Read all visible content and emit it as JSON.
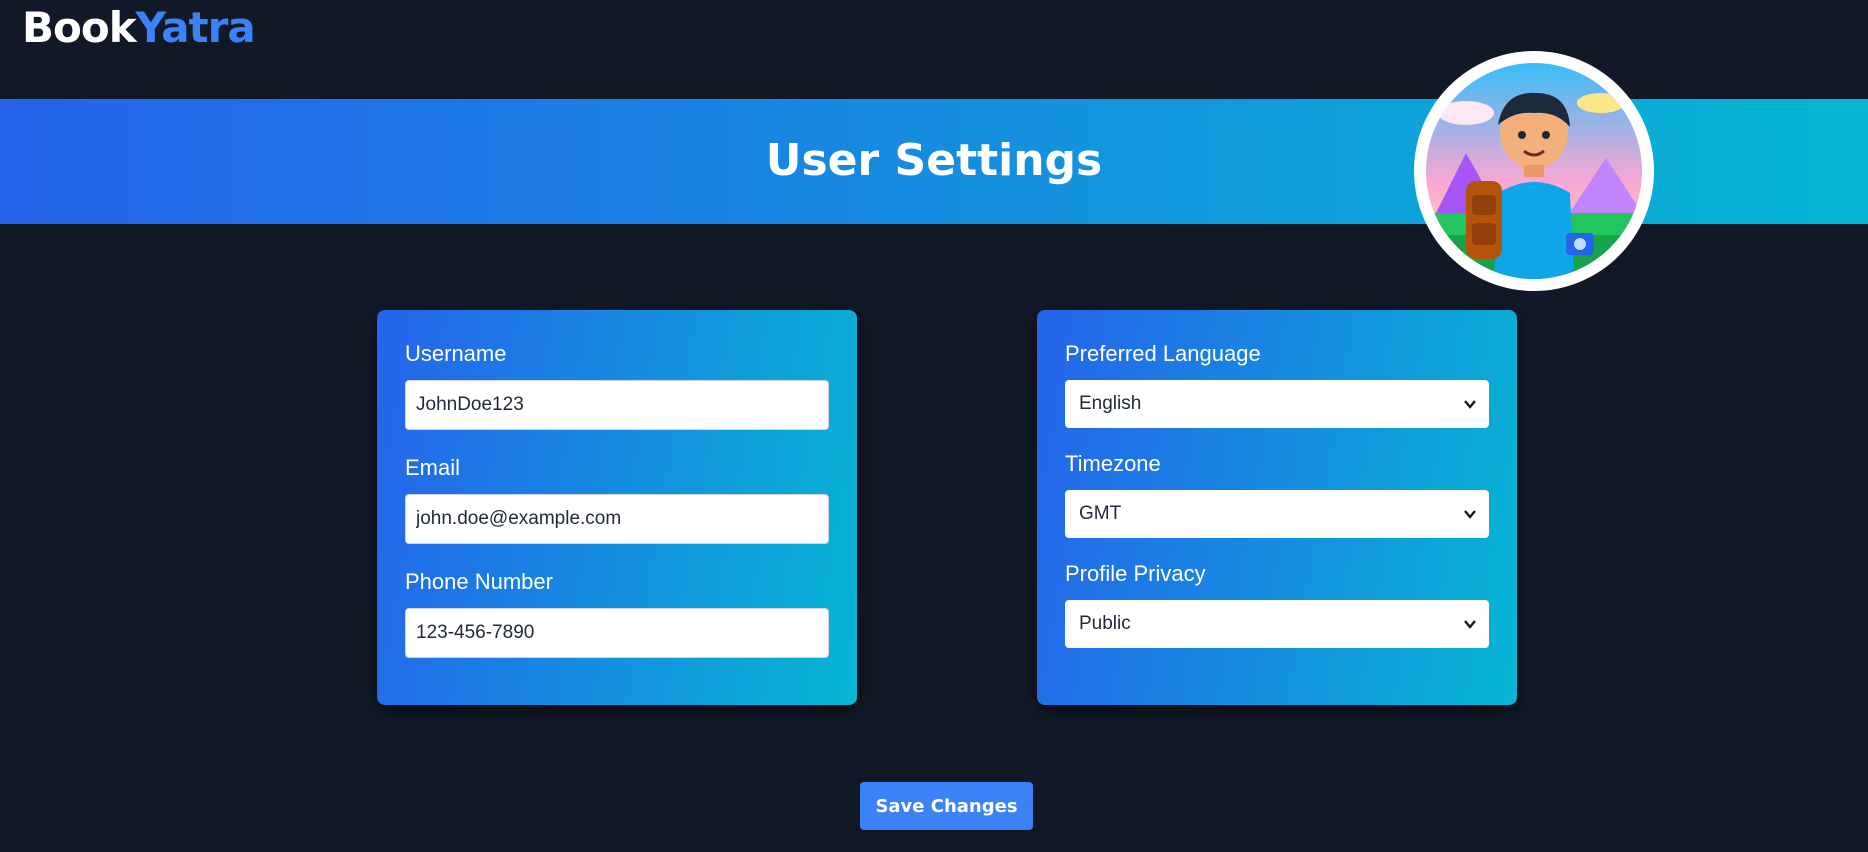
{
  "brand": {
    "part1": "Book",
    "part2": "Yatra",
    "accent_color": "#3b82f6"
  },
  "banner": {
    "title": "User Settings",
    "gradient": [
      "#2563eb",
      "#06b6d4"
    ]
  },
  "avatar": {
    "icon": "traveler-avatar-illustration"
  },
  "account_form": {
    "username": {
      "label": "Username",
      "value": "JohnDoe123"
    },
    "email": {
      "label": "Email",
      "value": "john.doe@example.com"
    },
    "phone": {
      "label": "Phone Number",
      "value": "123-456-7890"
    }
  },
  "preferences_form": {
    "language": {
      "label": "Preferred Language",
      "selected": "English"
    },
    "timezone": {
      "label": "Timezone",
      "selected": "GMT"
    },
    "privacy": {
      "label": "Profile Privacy",
      "selected": "Public"
    }
  },
  "actions": {
    "save_label": "Save Changes"
  },
  "colors": {
    "background": "#111827",
    "button": "#3b82f6"
  }
}
